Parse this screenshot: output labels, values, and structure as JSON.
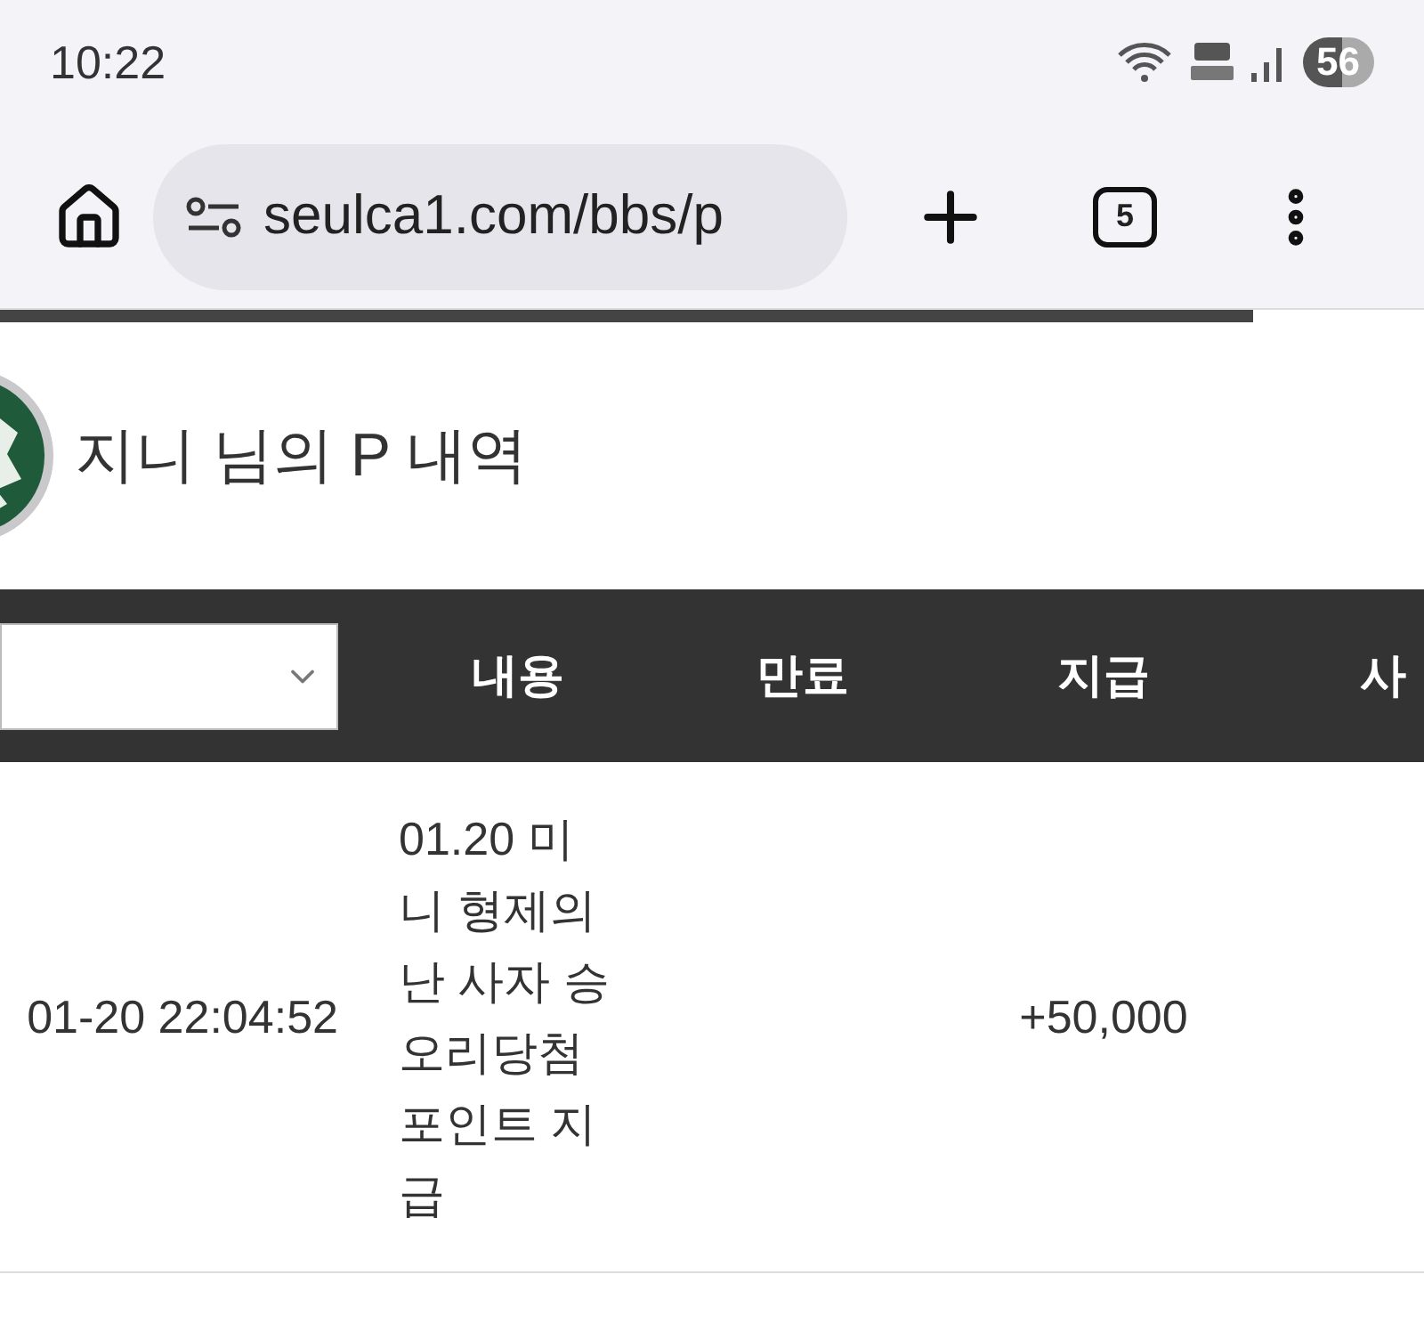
{
  "status_bar": {
    "time": "10:22",
    "battery": "56"
  },
  "browser": {
    "url": "seulca1.com/bbs/p",
    "tab_count": "5",
    "loading": {
      "level": 0.88
    }
  },
  "page": {
    "title": "지니 님의 P 내역"
  },
  "table": {
    "columns": [
      {
        "kind": "select"
      },
      {
        "kind": "text",
        "label": "내용"
      },
      {
        "kind": "text",
        "label": "만료"
      },
      {
        "kind": "text",
        "label": "지급"
      },
      {
        "kind": "text",
        "label": "사"
      }
    ],
    "rows": [
      {
        "date": "01-20 22:04:52",
        "content": "01.20 미니 형제의난 사자 승오리당첨 포인트 지급",
        "amount": "+50,000"
      }
    ]
  }
}
